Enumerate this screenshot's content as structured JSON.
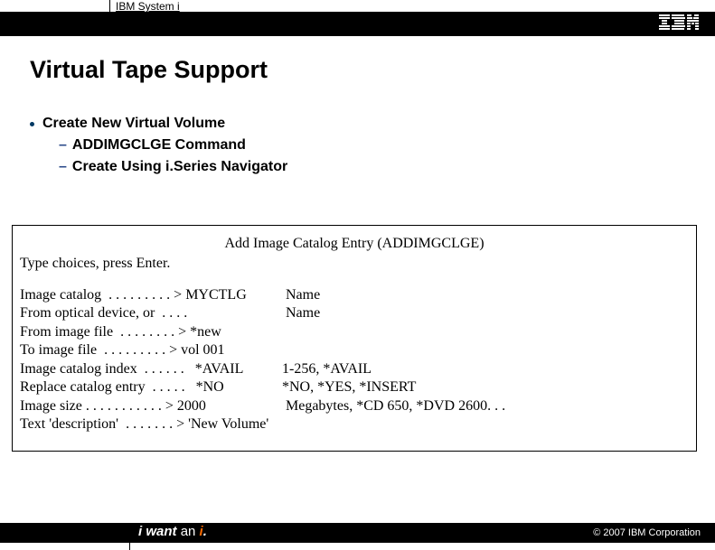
{
  "header": {
    "product_label": "IBM System i"
  },
  "slide": {
    "title": "Virtual Tape Support"
  },
  "bullets": {
    "main": "Create New Virtual Volume",
    "sub1": "ADDIMGCLGE Command",
    "sub2": "Create Using i.Series Navigator"
  },
  "screen": {
    "title": "Add Image Catalog Entry (ADDIMGCLGE)",
    "prompt": "Type choices, press Enter.",
    "rows": [
      {
        "label": "Image catalog  . . . . . . . . . > MYCTLG",
        "hint": " Name"
      },
      {
        "label": "From optical device, or  . . . .",
        "hint": " Name"
      },
      {
        "label": "From image file  . . . . . . . . > *new",
        "hint": ""
      },
      {
        "label": "To image file  . . . . . . . . . > vol 001",
        "hint": ""
      },
      {
        "label": "Image catalog index  . . . . . .   *AVAIL",
        "hint": "1-256, *AVAIL"
      },
      {
        "label": "Replace catalog entry  . . . . .   *NO",
        "hint": "*NO, *YES, *INSERT"
      },
      {
        "label": "Image size . . . . . . . . . . . > 2000",
        "hint": " Megabytes, *CD 650, *DVD 2600. . ."
      },
      {
        "label": "Text 'description'  . . . . . . . > 'New Volume'",
        "hint": ""
      }
    ]
  },
  "footer": {
    "tag_a": "i want",
    "tag_b": "an",
    "tag_c": "i",
    "tag_d": ".",
    "copyright": "© 2007 IBM Corporation"
  }
}
